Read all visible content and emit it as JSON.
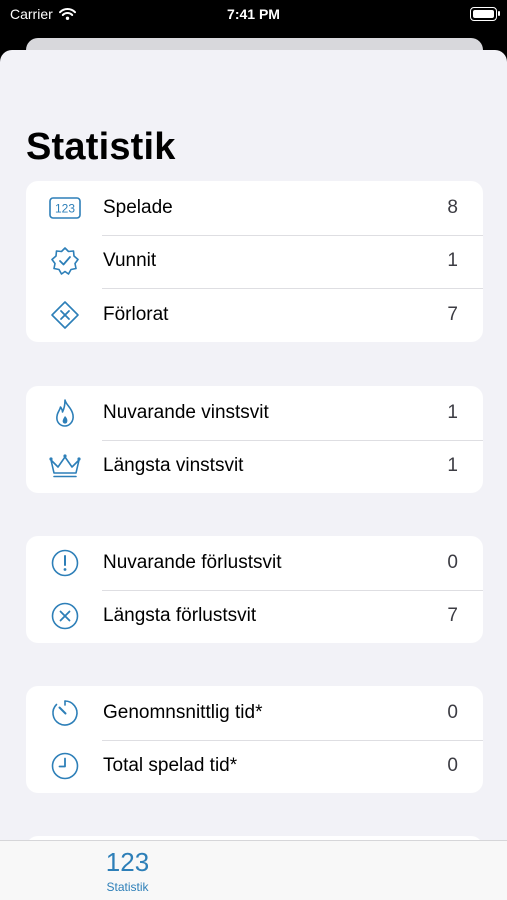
{
  "status_bar": {
    "carrier": "Carrier",
    "time": "7:41 PM"
  },
  "page": {
    "title": "Statistik"
  },
  "groups": [
    {
      "rows": [
        {
          "icon": "number-123-icon",
          "label": "Spelade",
          "value": "8"
        },
        {
          "icon": "checkmark-seal-icon",
          "label": "Vunnit",
          "value": "1"
        },
        {
          "icon": "xmark-diamond-icon",
          "label": "Förlorat",
          "value": "7"
        }
      ]
    },
    {
      "rows": [
        {
          "icon": "flame-icon",
          "label": "Nuvarande vinstsvit",
          "value": "1"
        },
        {
          "icon": "crown-icon",
          "label": "Längsta vinstsvit",
          "value": "1"
        }
      ]
    },
    {
      "rows": [
        {
          "icon": "exclamation-circle-icon",
          "label": "Nuvarande förlustsvit",
          "value": "0"
        },
        {
          "icon": "xmark-circle-icon",
          "label": "Längsta förlustsvit",
          "value": "7"
        }
      ]
    },
    {
      "rows": [
        {
          "icon": "timer-icon",
          "label": "Genomnsnittlig tid*",
          "value": "0"
        },
        {
          "icon": "clock-icon",
          "label": "Total spelad tid*",
          "value": "0"
        }
      ]
    }
  ],
  "tab_bar": {
    "items": [
      {
        "icon_text": "123",
        "label": "Statistik",
        "selected": true
      }
    ]
  },
  "colors": {
    "accent": "#2d7fb8",
    "background": "#f2f2f7",
    "card": "#ffffff"
  }
}
